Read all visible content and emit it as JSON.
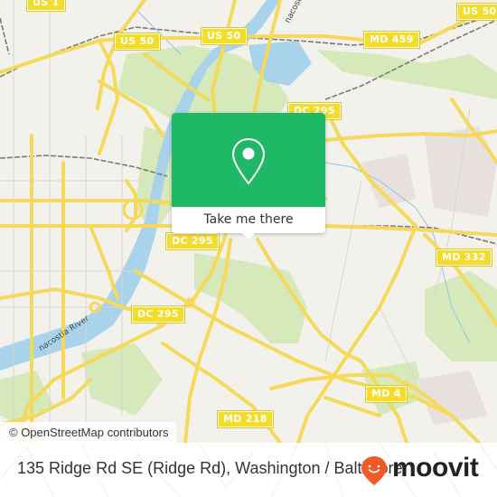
{
  "map": {
    "shields": [
      {
        "id": "us1",
        "label": "US 1"
      },
      {
        "id": "us50-west",
        "label": "US 50"
      },
      {
        "id": "us50-mid",
        "label": "US 50"
      },
      {
        "id": "us50-east",
        "label": "US 50"
      },
      {
        "id": "md459",
        "label": "MD 459"
      },
      {
        "id": "dc295-north",
        "label": "DC 295"
      },
      {
        "id": "dc295-mid",
        "label": "DC 295"
      },
      {
        "id": "dc295-south",
        "label": "DC 295"
      },
      {
        "id": "md332",
        "label": "MD 332"
      },
      {
        "id": "md4",
        "label": "MD 4"
      },
      {
        "id": "md218",
        "label": "MD 218"
      }
    ],
    "river_labels": {
      "anacostia_north": "nacostia Ri",
      "anacostia_south": "nacostia River"
    },
    "attribution": "© OpenStreetMap contributors",
    "colors": {
      "land": "#f2f1ec",
      "park": "#cfe6b2",
      "water": "#a9d3ea",
      "road": "#f7dd5e",
      "rail": "#777777"
    }
  },
  "popup": {
    "icon": "map-pin-icon",
    "action_label": "Take me there",
    "color": "#1fb866"
  },
  "footer": {
    "address": "135 Ridge Rd SE (Ridge Rd), Washington / Baltimore",
    "brand": "moovit",
    "brand_color": "#f05a28"
  }
}
